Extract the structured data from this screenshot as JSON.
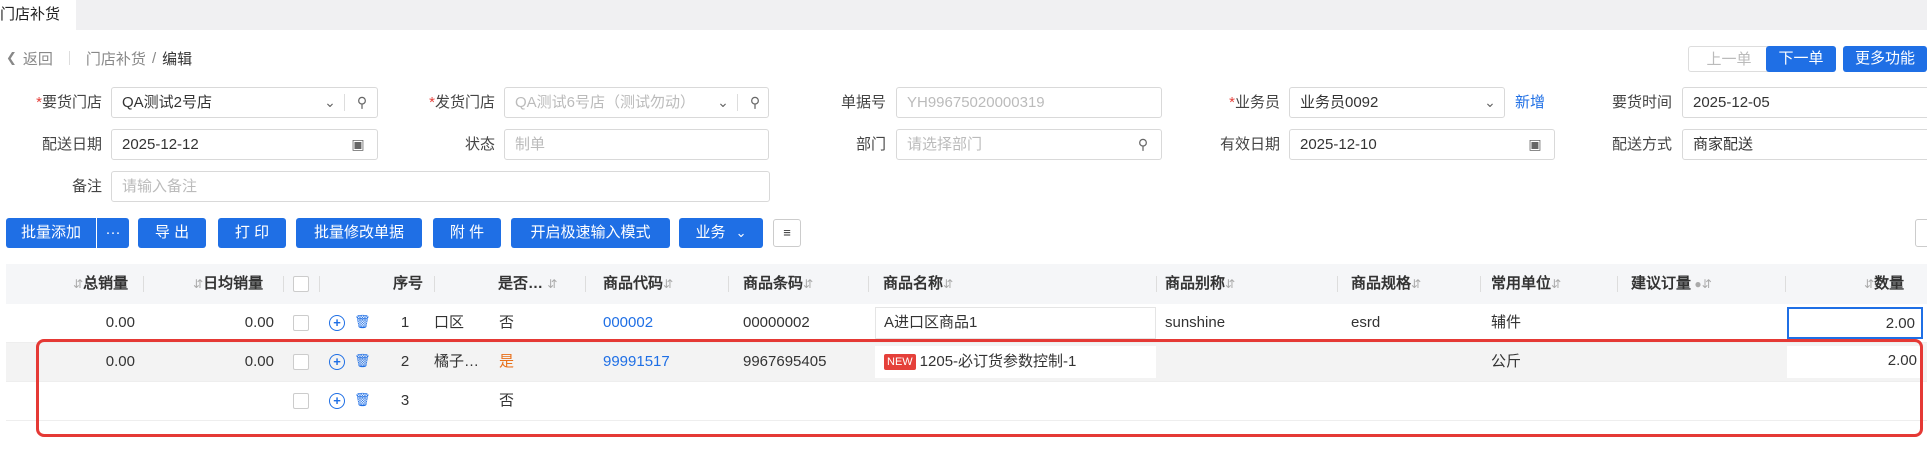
{
  "tab": {
    "title": "门店补货"
  },
  "breadcrumb": {
    "back": "返回",
    "parent": "门店补货",
    "separator": "/",
    "current": "编辑"
  },
  "nav": {
    "prev": "上一单",
    "next": "下一单",
    "more": "更多功能"
  },
  "form": {
    "req_store": {
      "label": "要货门店",
      "value": "QA测试2号店"
    },
    "ship_store": {
      "label": "发货门店",
      "placeholder": "QA测试6号店（测试勿动）"
    },
    "doc_no": {
      "label": "单据号",
      "placeholder": "YH99675020000319"
    },
    "salesman": {
      "label": "业务员",
      "value": "业务员0092",
      "add": "新增"
    },
    "req_time": {
      "label": "要货时间",
      "value": "2025-12-05"
    },
    "ship_date": {
      "label": "配送日期",
      "value": "2025-12-12"
    },
    "status": {
      "label": "状态",
      "placeholder": "制单"
    },
    "dept": {
      "label": "部门",
      "placeholder": "请选择部门"
    },
    "valid_date": {
      "label": "有效日期",
      "value": "2025-12-10"
    },
    "ship_mode": {
      "label": "配送方式",
      "value": "商家配送"
    },
    "remark": {
      "label": "备注",
      "placeholder": "请输入备注"
    }
  },
  "toolbar": {
    "batch_add": "批量添加",
    "more": "···",
    "export": "导 出",
    "print": "打 印",
    "batch_edit": "批量修改单据",
    "attach": "附 件",
    "fast_mode": "开启极速输入模式",
    "business": "业务"
  },
  "table": {
    "headers": {
      "total_sales": "总销量",
      "daily_sales": "日均销量",
      "seq": "序号",
      "is_x": "是否…",
      "code": "商品代码",
      "barcode": "商品条码",
      "name": "商品名称",
      "alias": "商品别称",
      "spec": "商品规格",
      "unit": "常用单位",
      "suggest": "建议订量",
      "qty": "数量"
    },
    "rows": [
      {
        "total_sales": "0.00",
        "daily_sales": "0.00",
        "seq": "1",
        "area": "口区",
        "is_x": "否",
        "code": "000002",
        "barcode": "00000002",
        "name": "A进口区商品1",
        "alias": "sunshine",
        "spec": "esrd",
        "unit": "辅件",
        "qty": "2.00"
      },
      {
        "total_sales": "0.00",
        "daily_sales": "0.00",
        "seq": "2",
        "area": "橘子…",
        "is_x": "是",
        "code": "99991517",
        "barcode": "9967695405",
        "badge": "NEW",
        "name": "1205-必订货参数控制-1",
        "alias": "",
        "spec": "",
        "unit": "公斤",
        "qty": "2.00"
      },
      {
        "total_sales": "",
        "daily_sales": "",
        "seq": "3",
        "area": "",
        "is_x": "否",
        "code": "",
        "barcode": "",
        "name": "",
        "alias": "",
        "spec": "",
        "unit": "",
        "qty": ""
      }
    ]
  },
  "colors": {
    "primary": "#1f6fe5",
    "required": "#e5403a",
    "highlight_box": "#e53935",
    "is_yes": "#e8701a"
  }
}
